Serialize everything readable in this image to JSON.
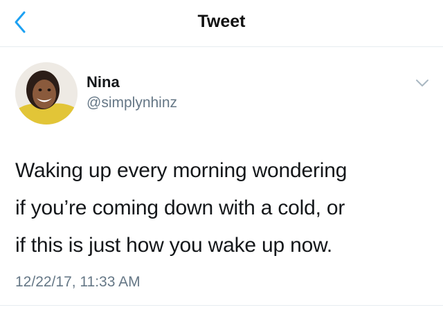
{
  "header": {
    "title": "Tweet",
    "back_icon": "chevron-left-icon",
    "accent_color": "#1da1f2"
  },
  "tweet": {
    "author_name": "Nina",
    "author_handle": "@simplynhinz",
    "menu_icon": "chevron-down-icon",
    "text_lines": [
      "Waking up every morning wondering",
      "if you’re coming down with a cold, or",
      "if this is just how you wake up now."
    ],
    "timestamp": "12/22/17, 11:33 AM"
  }
}
